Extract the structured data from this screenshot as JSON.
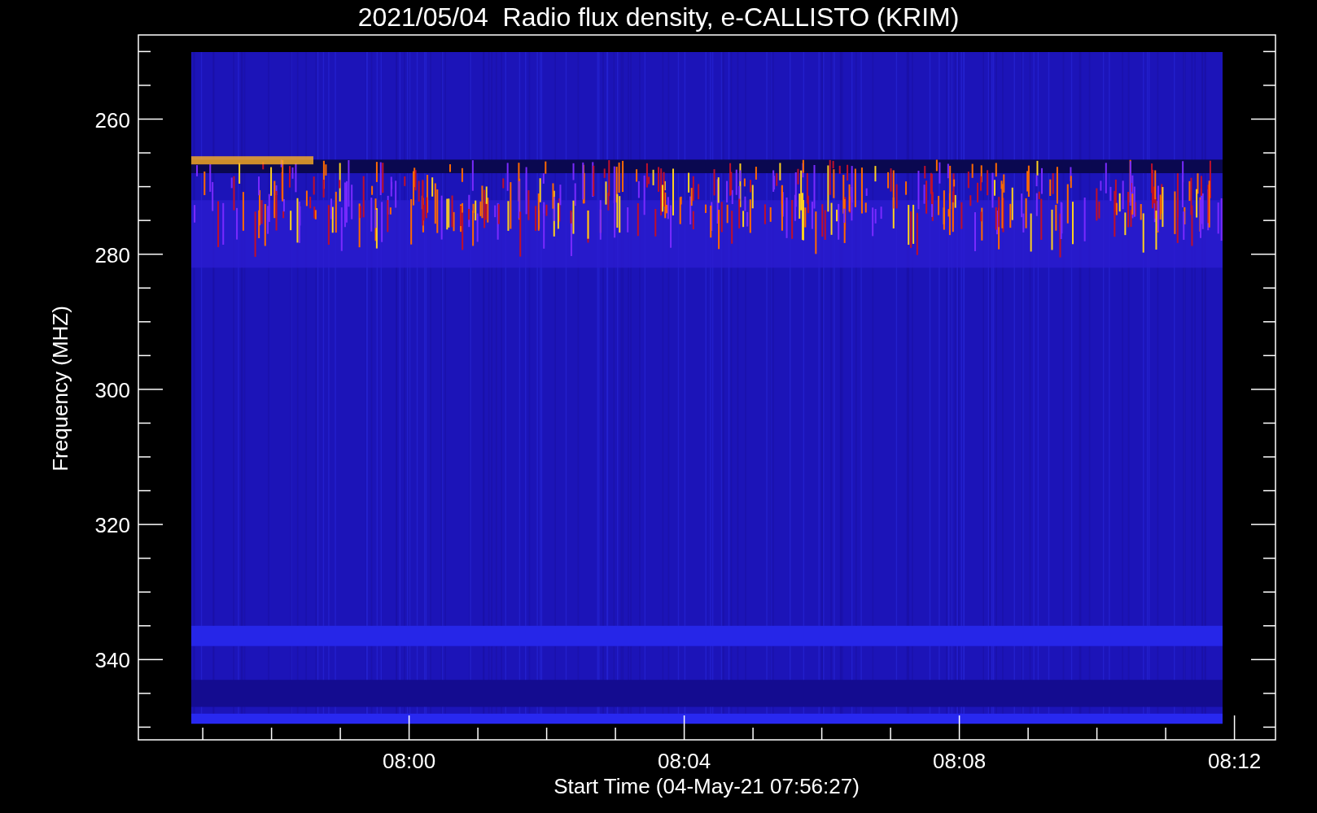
{
  "title": "2021/05/04  Radio flux density, e-CALLISTO (KRIM)",
  "y_axis": {
    "label": "Frequency (MHZ)",
    "ticks": [
      "260",
      "280",
      "300",
      "320",
      "340"
    ]
  },
  "x_axis": {
    "label": "Start Time (04-May-21 07:56:27)",
    "ticks": [
      "08:00",
      "08:04",
      "08:08",
      "08:12"
    ]
  }
}
